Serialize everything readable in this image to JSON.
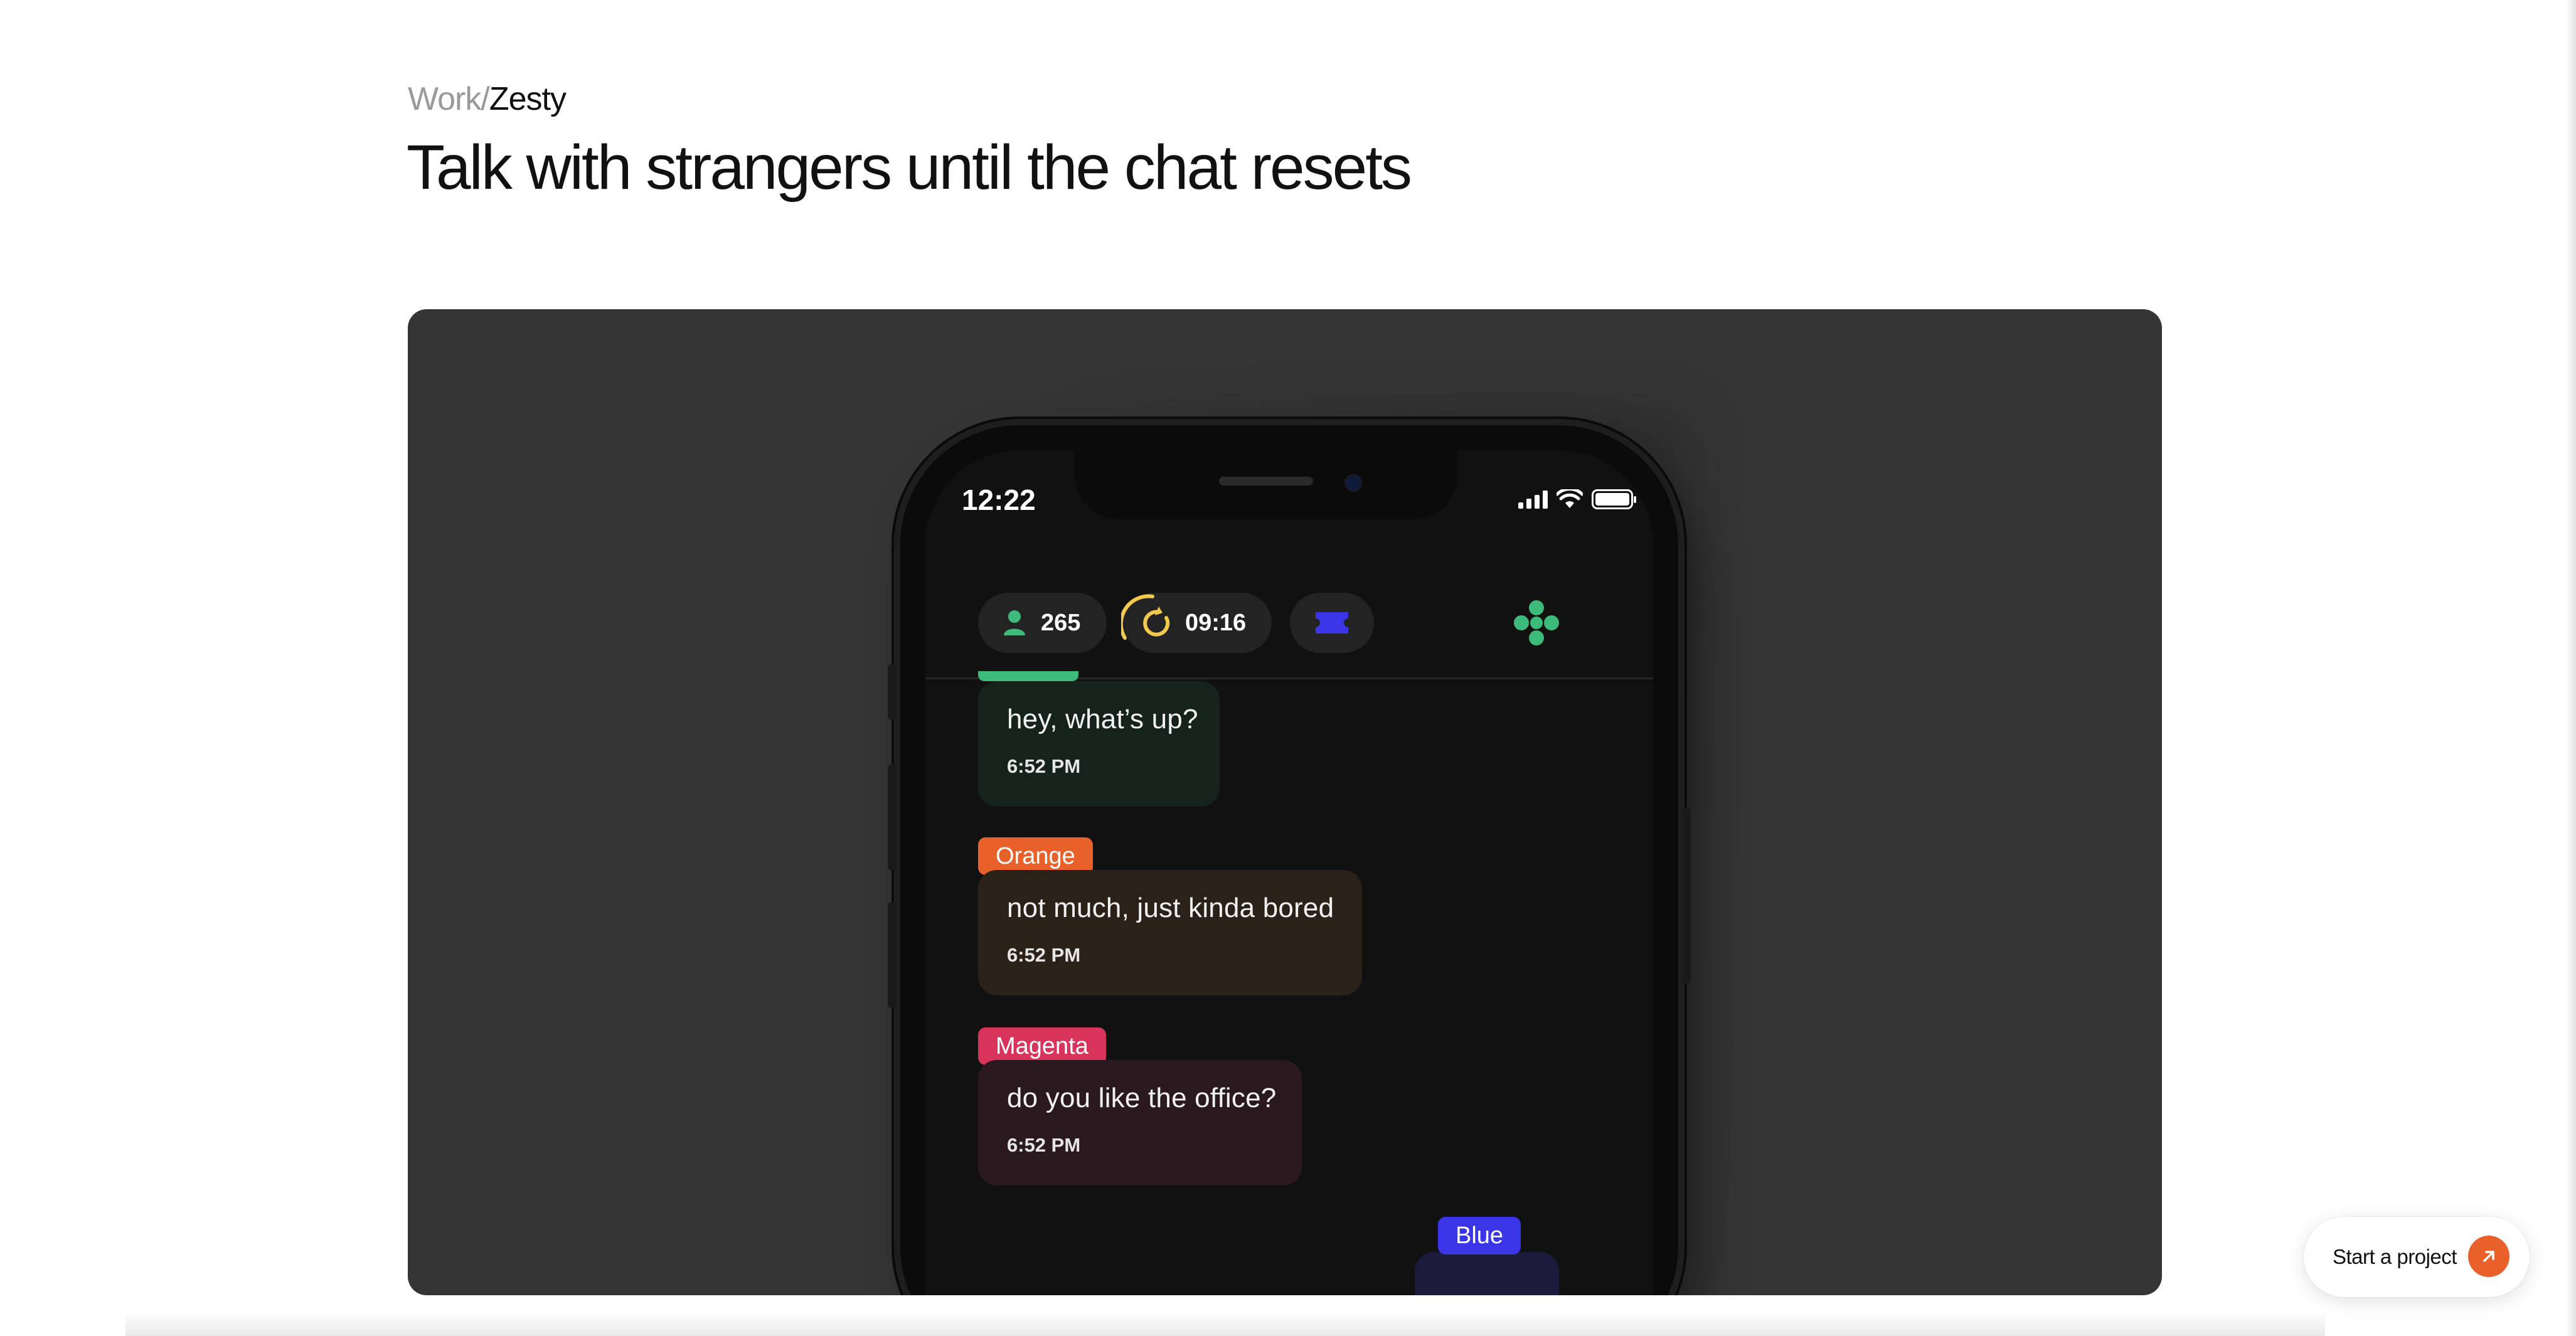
{
  "breadcrumb": {
    "parent": "Work",
    "separator": "/",
    "current": "Zesty"
  },
  "page_title": "Talk with strangers until the chat resets",
  "phone": {
    "status_time": "12:22",
    "toolbar": {
      "user_count": "265",
      "timer": "09:16"
    },
    "messages": [
      {
        "text": "hey, what’s up?",
        "time": "6:52 PM"
      },
      {
        "tag": "Orange",
        "text": "not much, just kinda bored",
        "time": "6:52 PM"
      },
      {
        "tag": "Magenta",
        "text": "do you like the office?",
        "time": "6:52 PM"
      },
      {
        "tag": "Blue"
      }
    ]
  },
  "cta": {
    "label": "Start a project"
  },
  "colors": {
    "orange": "#e8602a",
    "magenta": "#d8335b",
    "blue": "#3b35e8",
    "green": "#3dbb7a",
    "timer_yellow": "#f2c94c",
    "hero_bg": "#353535"
  },
  "icons": [
    "user-icon",
    "refresh-icon",
    "ticket-icon",
    "clover-icon",
    "signal-icon",
    "wifi-icon",
    "battery-icon",
    "arrow-up-right-icon"
  ]
}
